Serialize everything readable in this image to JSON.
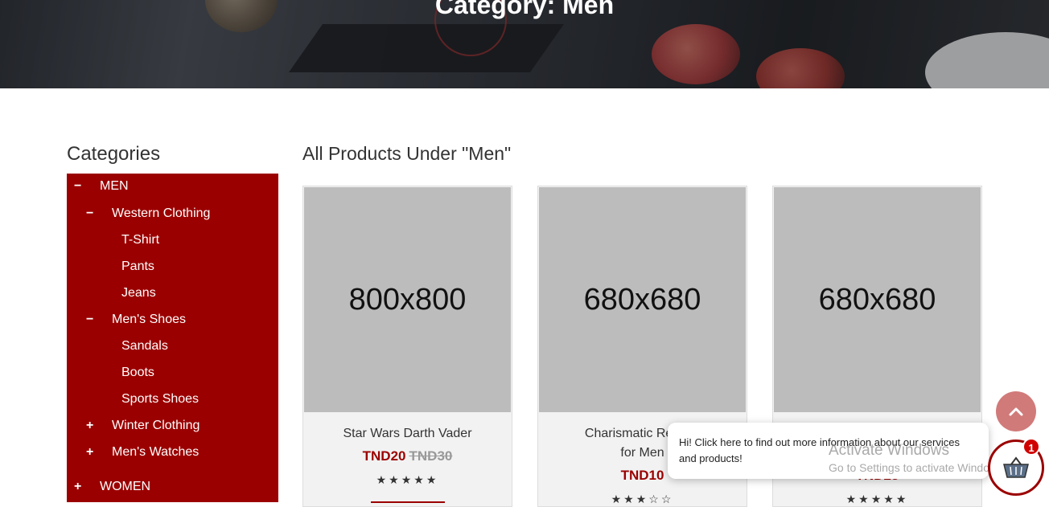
{
  "hero": {
    "title": "Category: Men"
  },
  "sidebar": {
    "heading": "Categories",
    "items": [
      {
        "toggle": "−",
        "label": "MEN"
      },
      {
        "toggle": "−",
        "label": "Western Clothing"
      },
      {
        "toggle": "",
        "label": "T-Shirt"
      },
      {
        "toggle": "",
        "label": "Pants"
      },
      {
        "toggle": "",
        "label": "Jeans"
      },
      {
        "toggle": "−",
        "label": "Men's Shoes"
      },
      {
        "toggle": "",
        "label": "Sandals"
      },
      {
        "toggle": "",
        "label": "Boots"
      },
      {
        "toggle": "",
        "label": "Sports Shoes"
      },
      {
        "toggle": "+",
        "label": "Winter Clothing"
      },
      {
        "toggle": "+",
        "label": "Men's Watches"
      },
      {
        "toggle": "+",
        "label": "WOMEN"
      }
    ]
  },
  "main": {
    "heading": "All Products Under \"Men\"",
    "products": [
      {
        "image_text": "800x800",
        "name": "Star Wars Darth Vader",
        "price": "TND20",
        "old_price": "TND30",
        "rating_stars": "★★★★★"
      },
      {
        "image_text": "680x680",
        "name": "Charismatic Red Co",
        "name2": "for Men",
        "price": "TND10",
        "old_price": "",
        "rating_stars": "★★★☆☆"
      },
      {
        "image_text": "680x680",
        "name": "",
        "price": "TND25",
        "old_price": "",
        "rating_stars": "★★★★★"
      }
    ]
  },
  "chat": {
    "message": "Hi! Click here to find out more information about our services and products!"
  },
  "watermark": {
    "line1": "Activate Windows",
    "line2": "Go to Settings to activate Windows."
  },
  "cart": {
    "count": "1"
  },
  "colors": {
    "brand": "#9b0000",
    "scroll_button": "#d17a7a"
  },
  "icons": {
    "scroll_top": "chevron-up-icon",
    "cart": "basket-icon"
  }
}
